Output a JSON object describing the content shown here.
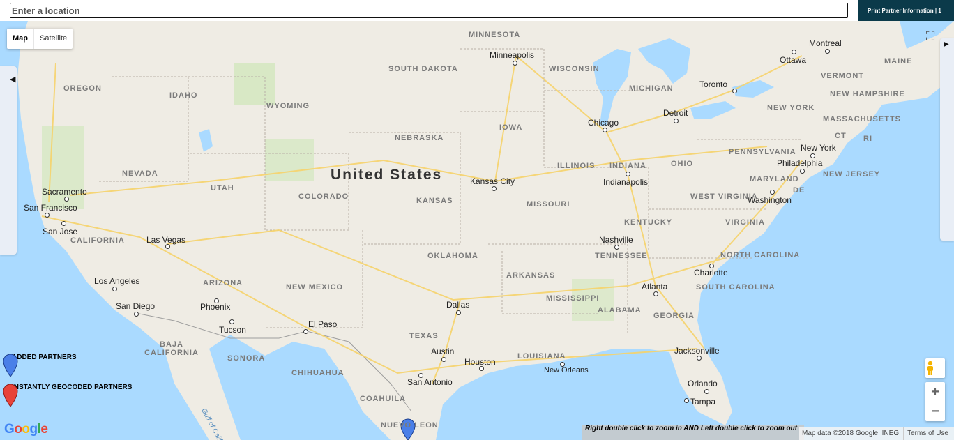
{
  "search": {
    "placeholder": "Enter a location"
  },
  "toolbar": {
    "print_label": "Print Partner Information | 1"
  },
  "map_type": {
    "map_label": "Map",
    "satellite_label": "Satellite",
    "selected": "Map"
  },
  "country_label": "United States",
  "states": [
    "MINNESOTA",
    "SOUTH DAKOTA",
    "WISCONSIN",
    "MICHIGAN",
    "OREGON",
    "IDAHO",
    "WYOMING",
    "NEBRASKA",
    "IOWA",
    "NEVADA",
    "UTAH",
    "COLORADO",
    "KANSAS",
    "MISSOURI",
    "ILLINOIS",
    "INDIANA",
    "OHIO",
    "PENNSYLVANIA",
    "NEW YORK",
    "VERMONT",
    "NEW HAMPSHIRE",
    "MASSACHUSETTS",
    "CT",
    "RI",
    "MAINE",
    "NEW JERSEY",
    "MARYLAND",
    "DE",
    "WEST VIRGINIA",
    "VIRGINIA",
    "KENTUCKY",
    "TENNESSEE",
    "NORTH CAROLINA",
    "SOUTH CAROLINA",
    "CALIFORNIA",
    "ARIZONA",
    "NEW MEXICO",
    "OKLAHOMA",
    "ARKANSAS",
    "MISSISSIPPI",
    "ALABAMA",
    "GEORGIA",
    "TEXAS",
    "LOUISIANA",
    "BAJA CALIFORNIA",
    "SONORA",
    "CHIHUAHUA",
    "COAHUILA",
    "NUEVO LEON"
  ],
  "cities": [
    "Minneapolis",
    "Montreal",
    "Ottawa",
    "Toronto",
    "Detroit",
    "Chicago",
    "Indianapolis",
    "Kansas City",
    "New York",
    "Philadelphia",
    "Washington",
    "Sacramento",
    "San Francisco",
    "San Jose",
    "Las Vegas",
    "Los Angeles",
    "San Diego",
    "Phoenix",
    "Tucson",
    "El Paso",
    "Dallas",
    "Austin",
    "Houston",
    "San Antonio",
    "Nashville",
    "Atlanta",
    "Charlotte",
    "Jacksonville",
    "New Orleans",
    "Orlando",
    "Tampa"
  ],
  "water_labels": [
    "Gulf of California"
  ],
  "legend": [
    {
      "label": "ADDED PARTNERS",
      "color": "#4a7fe8",
      "icon": "blue-pin-icon"
    },
    {
      "label": "INSTANTLY GEOCODED PARTNERS",
      "color": "#e8433a",
      "icon": "red-pin-icon"
    }
  ],
  "hint_text": "Right double click to zoom in AND Left double click to zoom out",
  "attribution": "Map data ©2018 Google, INEGI",
  "terms_label": "Terms of Use",
  "colors": {
    "land": "#efece4",
    "water": "#aadaff",
    "parks": "#c8e6b0",
    "highway": "#f6d36b",
    "print_button": "#0b3a4a"
  },
  "icons": {
    "side_left": "chevron-left-icon",
    "side_right": "chevron-right-icon",
    "fullscreen": "fullscreen-icon",
    "pegman": "pegman-icon",
    "zoom_in": "plus-icon",
    "zoom_out": "minus-icon",
    "logo": "google-logo"
  },
  "zoom": {
    "in_label": "+",
    "out_label": "−"
  }
}
